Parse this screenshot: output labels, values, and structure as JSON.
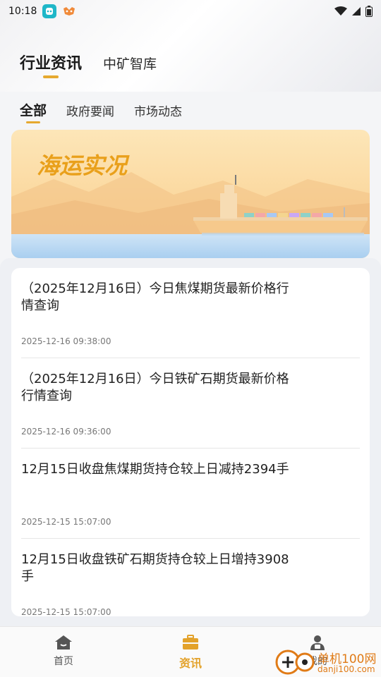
{
  "status_bar": {
    "time": "10:18"
  },
  "header": {
    "tabs": [
      {
        "label": "行业资讯",
        "active": true
      },
      {
        "label": "中矿智库",
        "active": false
      }
    ]
  },
  "sub_tabs": [
    {
      "label": "全部",
      "active": true
    },
    {
      "label": "政府要闻",
      "active": false
    },
    {
      "label": "市场动态",
      "active": false
    }
  ],
  "banner": {
    "title": "海运实况"
  },
  "news": [
    {
      "title": "（2025年12月16日）今日焦煤期货最新价格行情查询",
      "time": "2025-12-16 09:38:00"
    },
    {
      "title": "（2025年12月16日）今日铁矿石期货最新价格行情查询",
      "time": "2025-12-16 09:36:00"
    },
    {
      "title": "12月15日收盘焦煤期货持仓较上日减持2394手",
      "time": "2025-12-15 15:07:00"
    },
    {
      "title": "12月15日收盘铁矿石期货持仓较上日增持3908手",
      "time": "2025-12-15 15:07:00"
    }
  ],
  "bottom_nav": [
    {
      "label": "首页",
      "icon": "home-icon",
      "active": false
    },
    {
      "label": "资讯",
      "icon": "briefcase-icon",
      "active": true
    },
    {
      "label": "我的",
      "icon": "person-icon",
      "active": false
    }
  ],
  "watermark": {
    "line1": "单机100网",
    "line2": "danji100.com"
  },
  "colors": {
    "accent": "#e6a92f",
    "banner_bg": "#fbd99a",
    "banner_title": "#e9a01b",
    "watermark": "#e07b17"
  }
}
